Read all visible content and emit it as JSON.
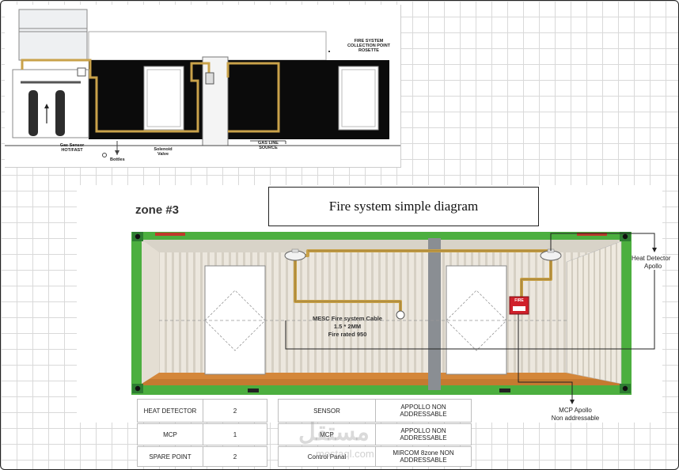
{
  "top_drawing": {
    "fire_collection_label": "FIRE SYSTEM\nCOLLECTION POINT\nROSETTE",
    "gas_sensor_label": "Gas Sensor\nHOT/FAST",
    "bottles_label": "Bottles",
    "solenoid_label": "Solenoid\nValve",
    "gas_line_label": "GAS LINE\nSOURCE"
  },
  "diagram": {
    "title": "Fire system simple diagram",
    "zone_label": "zone #3",
    "cable_label_1": "MESC Fire system Cable",
    "cable_label_2": "1.5 * 2MM",
    "cable_label_3": "Fire rated 950",
    "mcp_text": "FIRE",
    "heat_detector_label_1": "Heat Detector",
    "heat_detector_label_2": "Apollo",
    "mcp_label_1": "MCP Apollo",
    "mcp_label_2": "Non addressable"
  },
  "count_table": [
    {
      "item": "HEAT DETECTOR",
      "qty": "2"
    },
    {
      "item": "MCP",
      "qty": "1"
    },
    {
      "item": "SPARE POINT",
      "qty": "2"
    }
  ],
  "spec_table": [
    {
      "item": "SENSOR",
      "spec": "APPOLLO NON\nADDRESSABLE"
    },
    {
      "item": "MCP",
      "spec": "APPOLLO NON\nADDRESSABLE"
    },
    {
      "item": "Control Panal",
      "spec": "MIRCOM 8zone NON\nADDRESSABLE"
    }
  ],
  "watermark": {
    "arabic": "مستقل",
    "latin": "mostaql.com"
  },
  "colors": {
    "container_green": "#4caf3f",
    "cable_gold": "#c9a24a",
    "mcp_red": "#d0202a",
    "wall": "#e9e4da",
    "floor": "#d4873a"
  }
}
